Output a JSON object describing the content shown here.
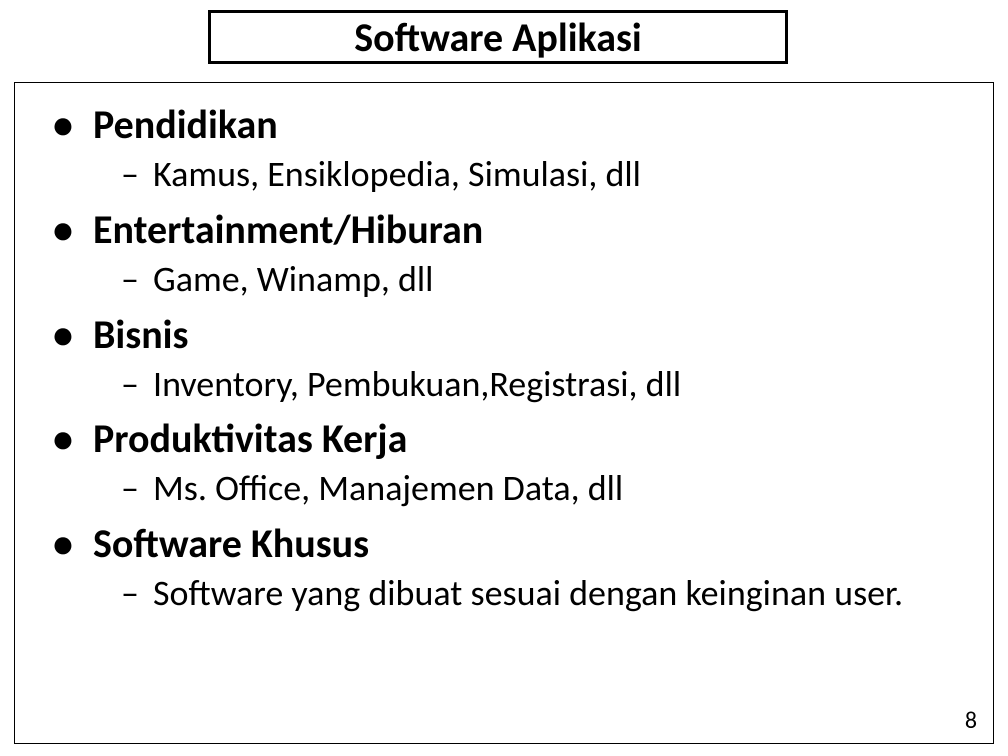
{
  "title": "Software Aplikasi",
  "items": [
    {
      "heading": "Pendidikan",
      "sub": "Kamus, Ensiklopedia, Simulasi, dll"
    },
    {
      "heading": "Entertainment/Hiburan",
      "sub": "Game, Winamp, dll"
    },
    {
      "heading": "Bisnis",
      "sub": "Inventory, Pembukuan,Registrasi, dll"
    },
    {
      "heading": "Produktivitas Kerja",
      "sub": "Ms. Office, Manajemen Data, dll"
    },
    {
      "heading": "Software Khusus",
      "sub": "Software yang dibuat sesuai dengan keinginan user."
    }
  ],
  "page_number": "8"
}
